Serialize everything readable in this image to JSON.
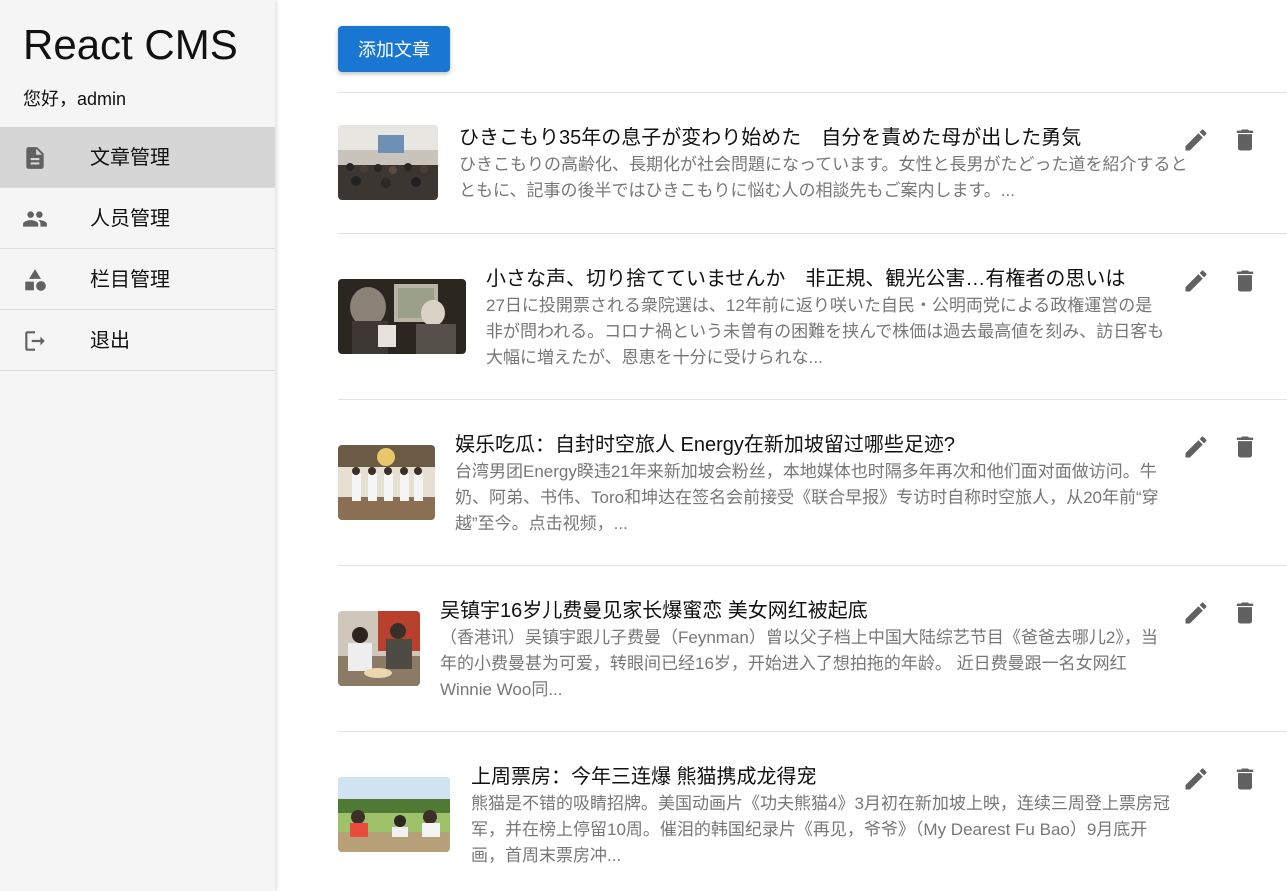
{
  "brand": {
    "title": "React CMS"
  },
  "user": {
    "greeting": "您好，admin"
  },
  "nav": {
    "items": [
      {
        "label": "文章管理",
        "icon": "article-icon",
        "active": true
      },
      {
        "label": "人员管理",
        "icon": "people-icon",
        "active": false
      },
      {
        "label": "栏目管理",
        "icon": "category-icon",
        "active": false
      },
      {
        "label": "退出",
        "icon": "logout-icon",
        "active": false
      }
    ]
  },
  "toolbar": {
    "add_label": "添加文章"
  },
  "colors": {
    "accent": "#1976d2",
    "sidebar_bg": "#f5f5f5",
    "active_item_bg": "#d6d6d6",
    "icon_gray": "#616161",
    "summary_gray": "#777777"
  },
  "articles": [
    {
      "title": "ひきこもり35年の息子が変わり始めた　自分を責めた母が出した勇気",
      "summary": "ひきこもりの高齢化、長期化が社会問題になっています。女性と長男がたどった道を紹介するとともに、記事の後半ではひきこもりに悩む人の相談先もご案内します。..."
    },
    {
      "title": "小さな声、切り捨てていませんか　非正規、観光公害…有権者の思いは",
      "summary": "27日に投開票される衆院選は、12年前に返り咲いた自民・公明両党による政権運営の是非が問われる。コロナ禍という未曽有の困難を挟んで株価は過去最高値を刻み、訪日客も大幅に増えたが、恩恵を十分に受けられな..."
    },
    {
      "title": "娱乐吃瓜：自封时空旅人 Energy在新加坡留过哪些足迹?",
      "summary": "台湾男团Energy睽违21年来新加坡会粉丝，本地媒体也时隔多年再次和他们面对面做访问。牛奶、阿弟、书伟、Toro和坤达在签名会前接受《联合早报》专访时自称时空旅人，从20年前“穿越”至今。点击视频，..."
    },
    {
      "title": "吴镇宇16岁儿费曼见家长爆蜜恋 美女网红被起底",
      "summary": "（香港讯）吴镇宇跟儿子费曼（Feynman）曾以父子档上中国大陆综艺节目《爸爸去哪儿2》，当年的小费曼甚为可爱，转眼间已经16岁，开始进入了想拍拖的年龄。 近日费曼跟一名女网红Winnie Woo同..."
    },
    {
      "title": "上周票房：今年三连爆 熊猫携成龙得宠",
      "summary": "熊猫是不错的吸睛招牌。美国动画片《功夫熊猫4》3月初在新加坡上映，连续三周登上票房冠军，并在榜上停留10周。催泪的韩国纪录片《再见，爷爷》（My Dearest Fu Bao）9月底开画，首周末票房冲..."
    }
  ]
}
